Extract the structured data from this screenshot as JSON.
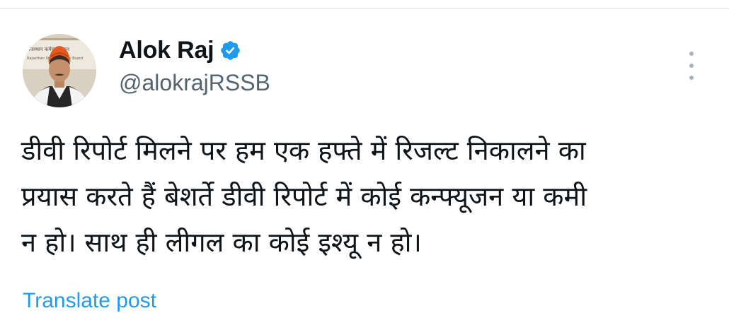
{
  "author": {
    "name": "Alok Raj",
    "handle": "@alokrajRSSB",
    "verified_color": "#1d9bf0"
  },
  "avatar": {
    "banner_line_1": "राजस्थान कर्मचारी चयन",
    "banner_line_2": "Rajasthan Staff Selection Board"
  },
  "tweet": {
    "text_lines": [
      "डीवी रिपोर्ट मिलने पर हम एक हफ्ते में रिजल्ट निकालने का",
      "प्रयास करते हैं बेशर्ते डीवी रिपोर्ट में कोई कन्फ्यूजन या कमी",
      "न हो। साथ ही लीगल का कोई इश्यू न हो।"
    ],
    "translate_label": "Translate post"
  },
  "icons": {
    "verified": "verified-check-icon",
    "more": "more-options-icon"
  },
  "colors": {
    "text": "#0f1419",
    "secondary": "#536471",
    "accent": "#1d9bf0",
    "divider": "#e3e6e8"
  }
}
